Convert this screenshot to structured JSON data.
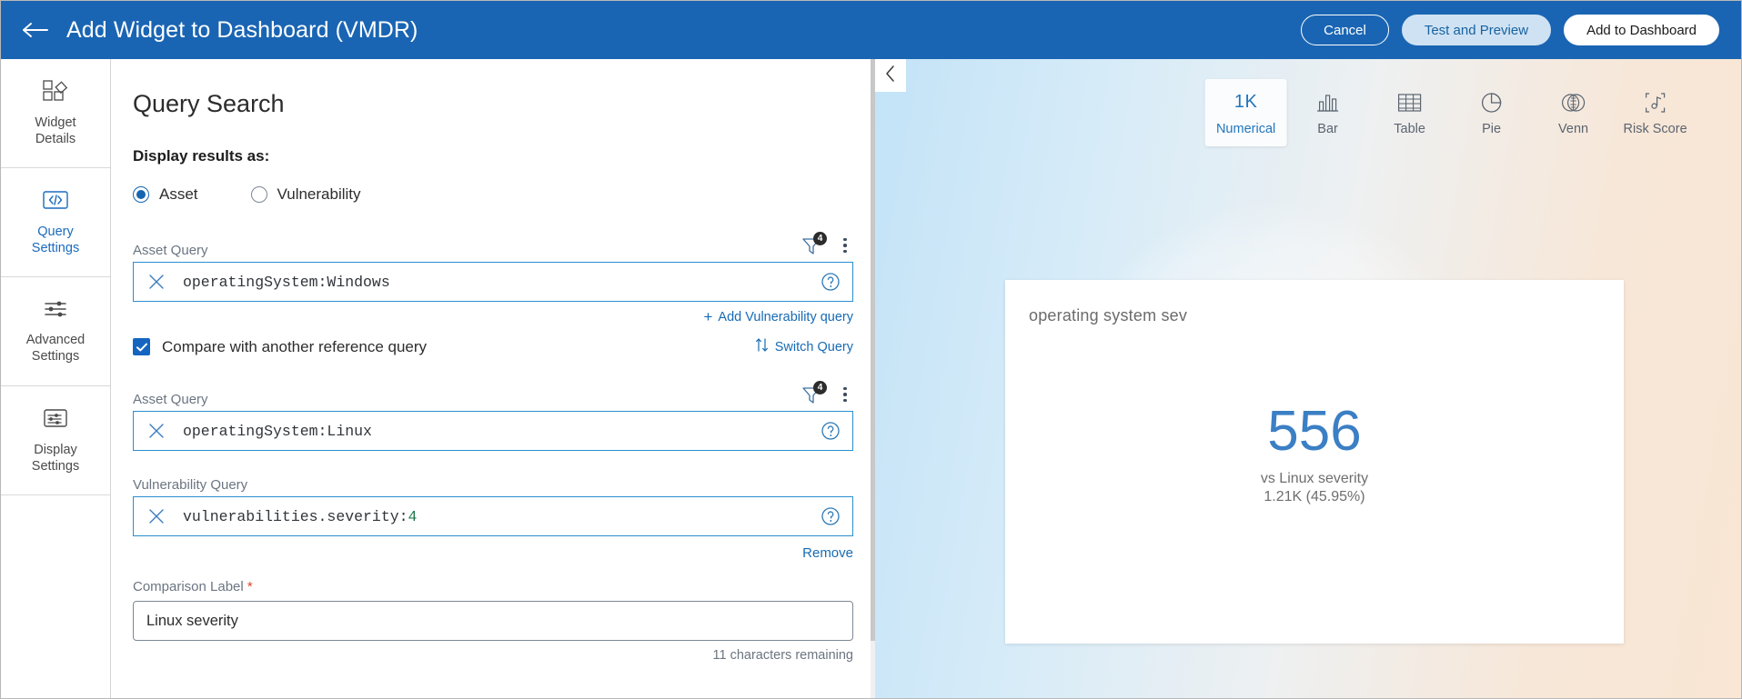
{
  "header": {
    "back_icon": "arrow-left-icon",
    "title": "Add Widget to Dashboard (VMDR)",
    "cancel_label": "Cancel",
    "test_preview_label": "Test and Preview",
    "add_label": "Add to Dashboard",
    "accent_bg": "#1a65b3"
  },
  "sidebar": {
    "items": [
      {
        "icon": "widget-details-icon",
        "line1": "Widget",
        "line2": "Details",
        "active": false
      },
      {
        "icon": "code-brackets-icon",
        "line1": "Query",
        "line2": "Settings",
        "active": true
      },
      {
        "icon": "sliders-icon",
        "line1": "Advanced",
        "line2": "Settings",
        "active": false
      },
      {
        "icon": "display-settings-icon",
        "line1": "Display",
        "line2": "Settings",
        "active": false
      }
    ],
    "active_color": "#1a6bbd"
  },
  "form": {
    "page_title": "Query Search",
    "display_results_label": "Display results as:",
    "radios": [
      {
        "label": "Asset",
        "checked": true
      },
      {
        "label": "Vulnerability",
        "checked": false
      }
    ],
    "query1": {
      "label": "Asset Query",
      "filter_badge": "4",
      "value": "operatingSystem:Windows",
      "clear_icon": "close-x-icon",
      "help_icon": "question-circle-icon",
      "filter_icon": "filter-funnel-icon",
      "kebab_icon": "more-vertical-icon"
    },
    "add_vuln_query_label": "Add Vulnerability query",
    "compare_checkbox_label": "Compare with another reference query",
    "compare_checked": true,
    "switch_query_label": "Switch Query",
    "switch_icon": "switch-arrows-icon",
    "query2": {
      "label": "Asset Query",
      "filter_badge": "4",
      "value": "operatingSystem:Linux",
      "clear_icon": "close-x-icon",
      "help_icon": "question-circle-icon",
      "filter_icon": "filter-funnel-icon",
      "kebab_icon": "more-vertical-icon"
    },
    "query3": {
      "label": "Vulnerability Query",
      "value_prefix": "vulnerabilities.severity:",
      "value_number": "4",
      "clear_icon": "close-x-icon",
      "help_icon": "question-circle-icon"
    },
    "remove_label": "Remove",
    "comparison_label": "Comparison Label",
    "comparison_required_mark": "*",
    "comparison_value": "Linux severity",
    "chars_remaining": "11 characters remaining"
  },
  "preview": {
    "collapse_icon": "chevron-left-icon",
    "chart_types": [
      {
        "label": "Numerical",
        "icon": "numeric-1k-icon",
        "icon_text": "1K",
        "active": true
      },
      {
        "label": "Bar",
        "icon": "bar-chart-icon",
        "active": false
      },
      {
        "label": "Table",
        "icon": "table-grid-icon",
        "active": false
      },
      {
        "label": "Pie",
        "icon": "pie-chart-icon",
        "active": false
      },
      {
        "label": "Venn",
        "icon": "venn-diagram-icon",
        "active": false
      },
      {
        "label": "Risk Score",
        "icon": "risk-score-icon",
        "active": false
      }
    ],
    "widget": {
      "title": "operating system sev",
      "value": "556",
      "compare_line": "vs Linux severity",
      "compare_detail": "1.21K (45.95%)",
      "value_color": "#3b7fc4"
    }
  }
}
